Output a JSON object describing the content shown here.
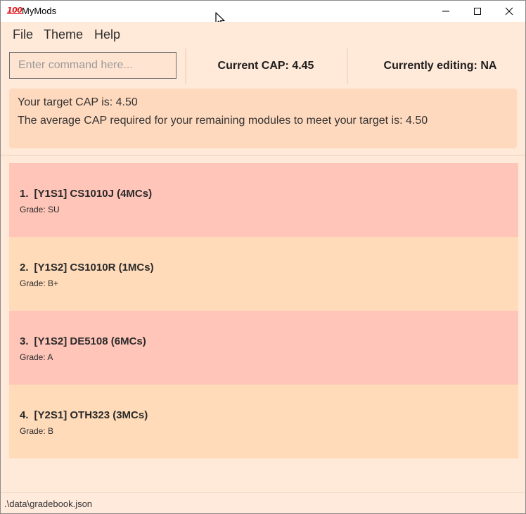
{
  "window": {
    "title": "MyMods",
    "icon": "hundred-points-icon",
    "icon_glyph": "100",
    "controls": [
      "minimize-icon",
      "maximize-icon",
      "close-icon"
    ]
  },
  "menu": {
    "file": "File",
    "theme": "Theme",
    "help": "Help"
  },
  "command": {
    "placeholder": "Enter command here...",
    "value": ""
  },
  "stats": {
    "current_cap": "Current CAP: 4.45",
    "currently_editing": "Currently editing: NA"
  },
  "target_info": {
    "line1": "Your target CAP is: 4.50",
    "line2": "The average CAP required for your remaining modules to meet your target is: 4.50"
  },
  "modules": [
    {
      "index": "1.",
      "title": "[Y1S1] CS1010J (4MCs)",
      "grade": "Grade: SU",
      "color": "#ffc5b8"
    },
    {
      "index": "2.",
      "title": "[Y1S2] CS1010R (1MCs)",
      "grade": "Grade: B+",
      "color": "#ffdbb9"
    },
    {
      "index": "3.",
      "title": "[Y1S2] DE5108 (6MCs)",
      "grade": "Grade: A",
      "color": "#ffc5b8"
    },
    {
      "index": "4.",
      "title": "[Y2S1] OTH323 (3MCs)",
      "grade": "Grade: B",
      "color": "#ffdbb9"
    }
  ],
  "status": {
    "file_path": ".\\data\\gradebook.json"
  },
  "colors": {
    "background": "#ffe9d9",
    "panel": "#ffd9bd",
    "module_red": "#ffc5b8",
    "module_orange": "#ffdbb9",
    "app_icon": "#e0191e"
  }
}
